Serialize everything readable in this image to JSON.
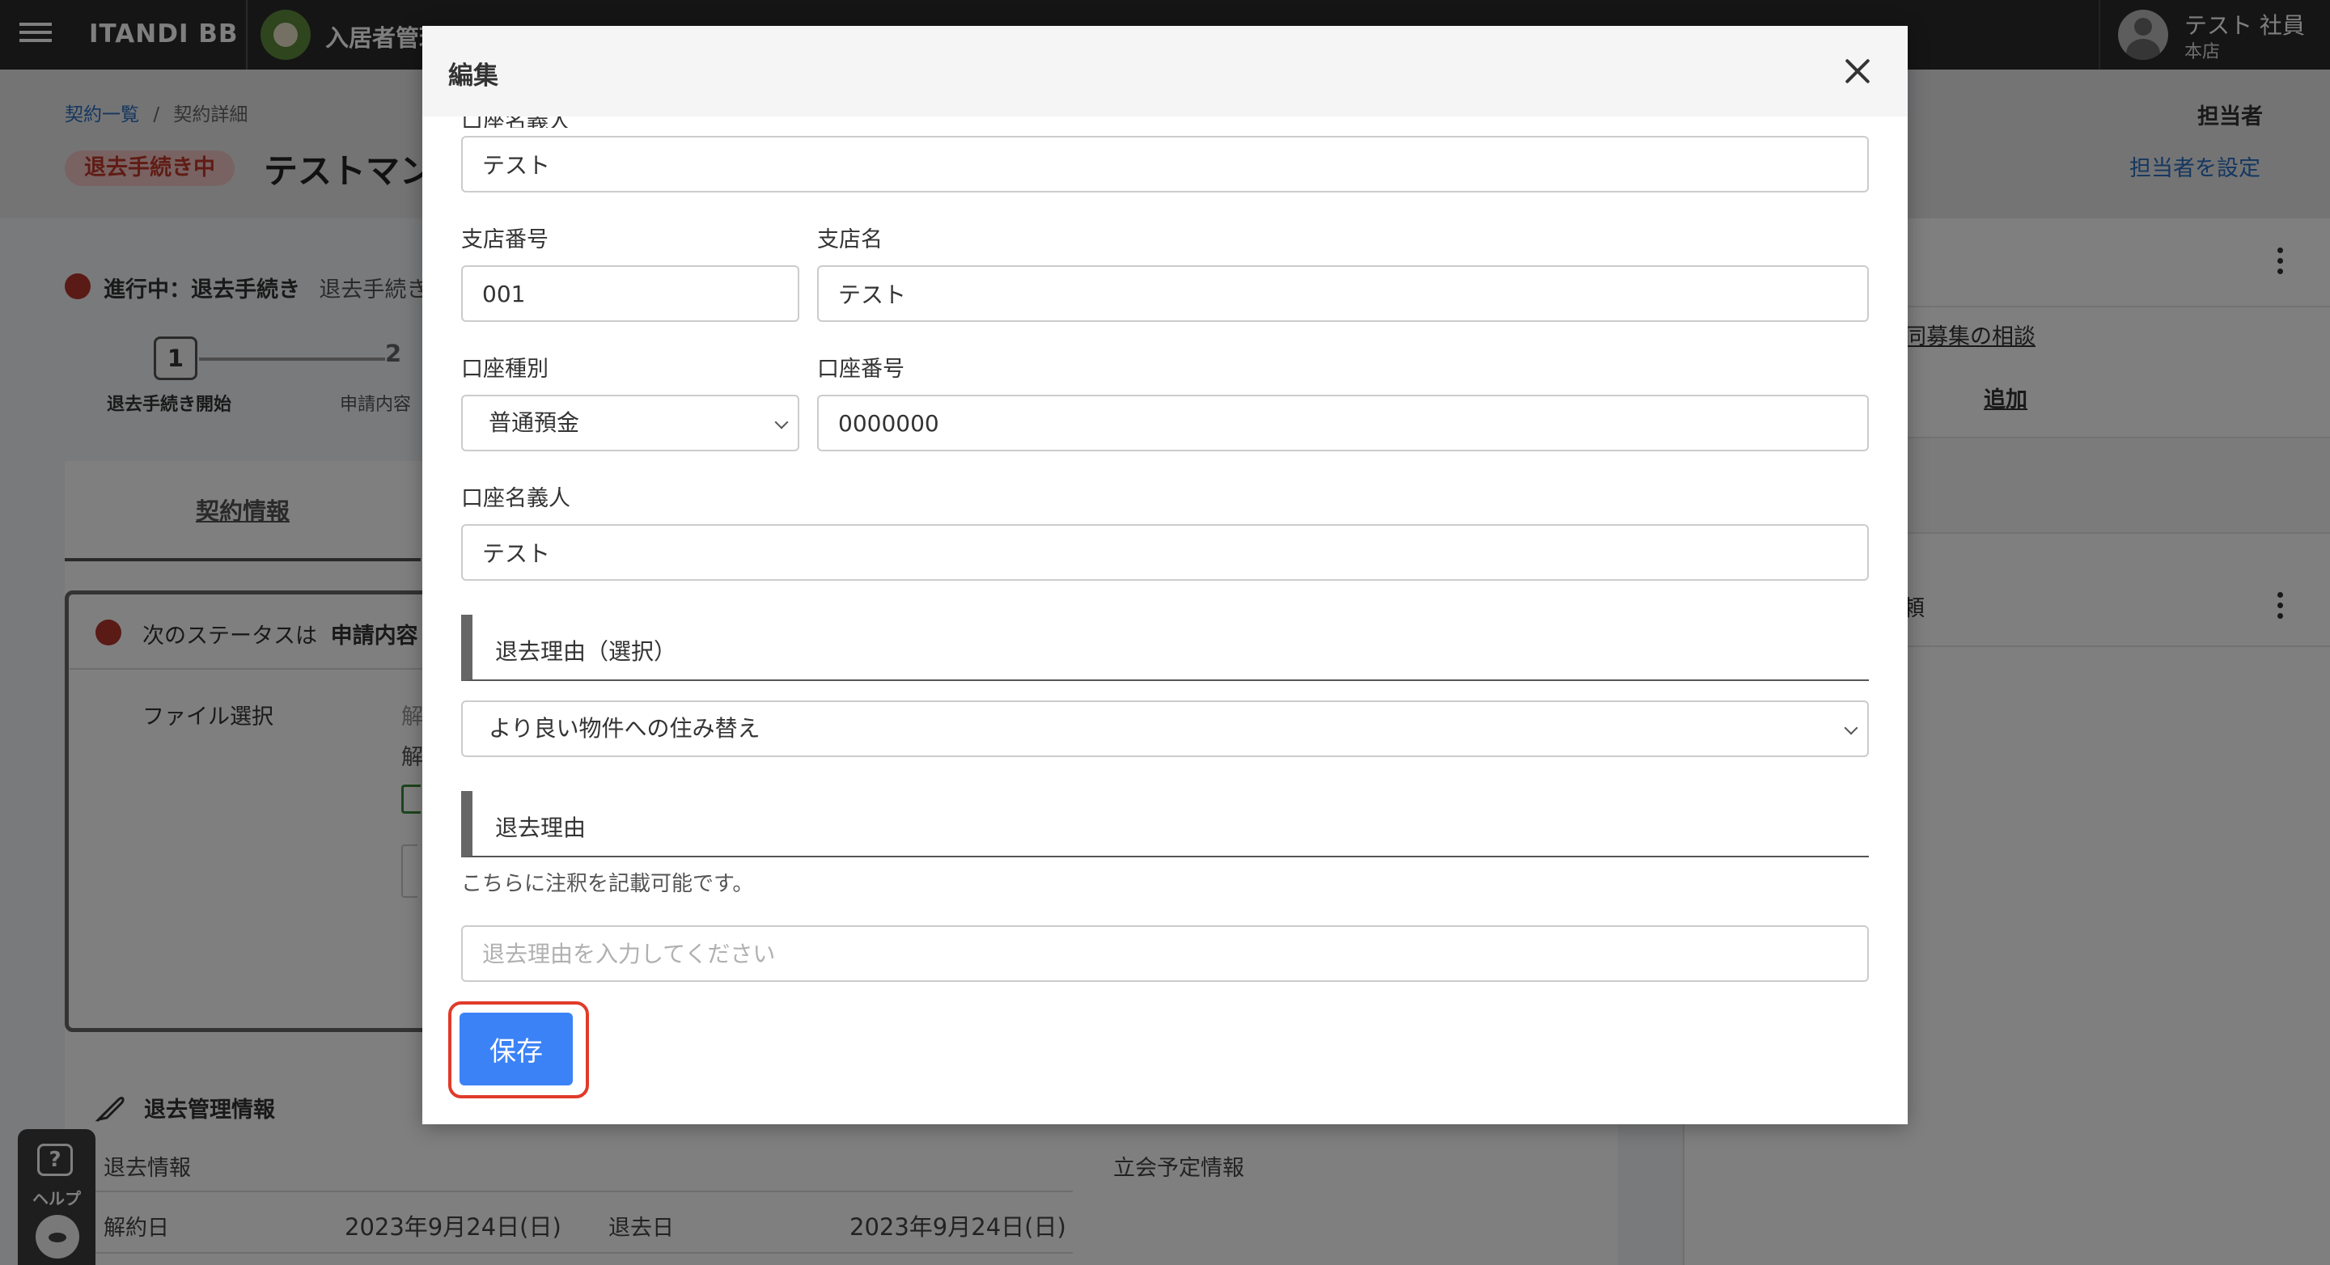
{
  "topbar": {
    "brand": "ITANDI BB",
    "app_name": "入居者管理",
    "user_name": "テスト 社員",
    "user_branch": "本店"
  },
  "header": {
    "breadcrumb": {
      "root": "契約一覧",
      "separator": "/",
      "current": "契約詳細"
    },
    "status_badge": "退去手続き中",
    "page_title": "テストマン",
    "assignee_label": "担当者",
    "assignee_link": "担当者を設定"
  },
  "progress": {
    "label": "進行中：退去手続き",
    "label_secondary": "退去手続き",
    "steps": [
      {
        "number": "1",
        "label": "退去手続き開始"
      },
      {
        "number": "2",
        "label": "申請内容"
      }
    ]
  },
  "tabs": [
    {
      "label": "契約情報"
    }
  ],
  "status_box": {
    "text": "次のステータスは",
    "bold": "申請内容",
    "file_label": "ファイル選択",
    "frag_1": "解",
    "frag_2": "解"
  },
  "management": {
    "title": "退去管理情報",
    "exit_info_label": "退去情報",
    "meeting_info_label": "立会予定情報",
    "cancel_date_label": "解約日",
    "cancel_date": "2023年9月24日(日)",
    "leave_date_label": "退去日",
    "leave_date": "2023年9月24日(日)"
  },
  "right_pane": {
    "link_1": "同募集の相談",
    "link_2": "追加",
    "text_2": "頼"
  },
  "help": {
    "label": "ヘルプ",
    "icon": "?"
  },
  "modal": {
    "title": "編集",
    "clipped_label": "口座名義人",
    "top_field_value": "テスト",
    "branch_number_label": "支店番号",
    "branch_number_value": "001",
    "branch_name_label": "支店名",
    "branch_name_value": "テスト",
    "account_type_label": "口座種別",
    "account_type_value": "普通預金",
    "account_number_label": "口座番号",
    "account_number_value": "0000000",
    "account_holder_label": "口座名義人",
    "account_holder_value": "テスト",
    "reason_select_heading": "退去理由（選択）",
    "reason_select_value": "より良い物件への住み替え",
    "reason_heading": "退去理由",
    "reason_note": "こちらに注釈を記載可能です。",
    "reason_placeholder": "退去理由を入力してください",
    "save_label": "保存"
  }
}
